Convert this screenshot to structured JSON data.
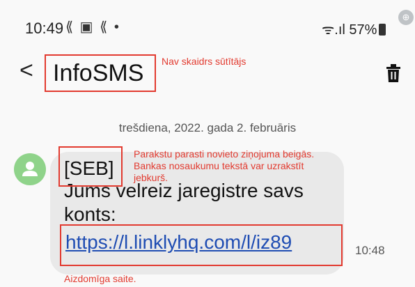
{
  "status_bar": {
    "time": "10:49",
    "left_icons": "⟪ ▣ ⟪ •",
    "battery_text": "57%",
    "signal_text": "ᯤ.ıl"
  },
  "header": {
    "title": "InfoSMS"
  },
  "thread": {
    "date": "trešdiena, 2022. gada 2. februāris",
    "message": {
      "line1": "[SEB]",
      "line2": "Jums velreiz jaregistre savs",
      "line3": "konts:",
      "link": "https://l.linklyhq.com/l/iz89",
      "time": "10:48"
    }
  },
  "annotations": {
    "sender": "Nav skaidrs sūtītājs",
    "signature_1": "Parakstu parasti novieto ziņojuma beigās.",
    "signature_2": "Bankas nosaukumu tekstā var uzrakstīt",
    "signature_3": "jebkurš.",
    "link": "Aizdomīga saite."
  },
  "colors": {
    "annotation": "#e23a2f",
    "bubble": "#e9e9e9",
    "avatar": "#8fd38a",
    "link": "#1f4db3"
  },
  "icons": [
    "back-icon",
    "trash-icon",
    "avatar-person-icon",
    "zoom-icon",
    "battery-icon"
  ]
}
